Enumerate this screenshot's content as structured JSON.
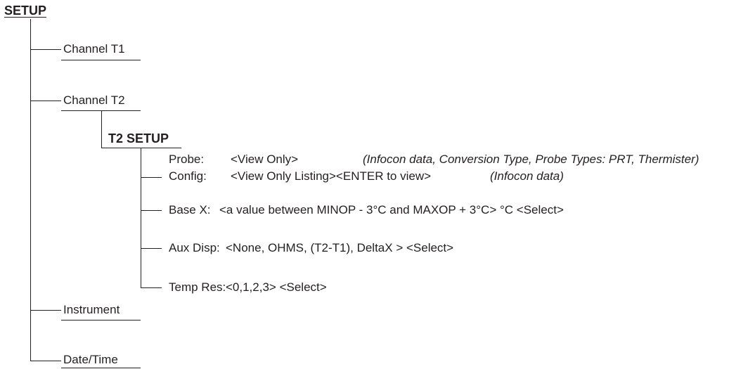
{
  "tree": {
    "root": "SETUP",
    "channel_t1": "Channel T1",
    "channel_t2": "Channel T2",
    "t2_setup": {
      "title": "T2 SETUP",
      "items": [
        {
          "label": "Probe:",
          "value": "<View Only>",
          "note": "(Infocon data, Conversion Type, Probe Types: PRT, Thermister)"
        },
        {
          "label": "Config:",
          "value": "<View Only Listing><ENTER to view>",
          "note": "(Infocon data)"
        },
        {
          "label": "Base X:",
          "value": "<a value between MINOP - 3°C and MAXOP + 3°C> °C  <Select>",
          "note": ""
        },
        {
          "label": "Aux Disp:",
          "value": "<None, OHMS, (T2-T1), DeltaX > <Select>",
          "note": ""
        },
        {
          "label": "Temp Res:",
          "value": "<0,1,2,3> <Select>",
          "note": ""
        }
      ]
    },
    "instrument": "Instrument",
    "date_time": "Date/Time"
  }
}
